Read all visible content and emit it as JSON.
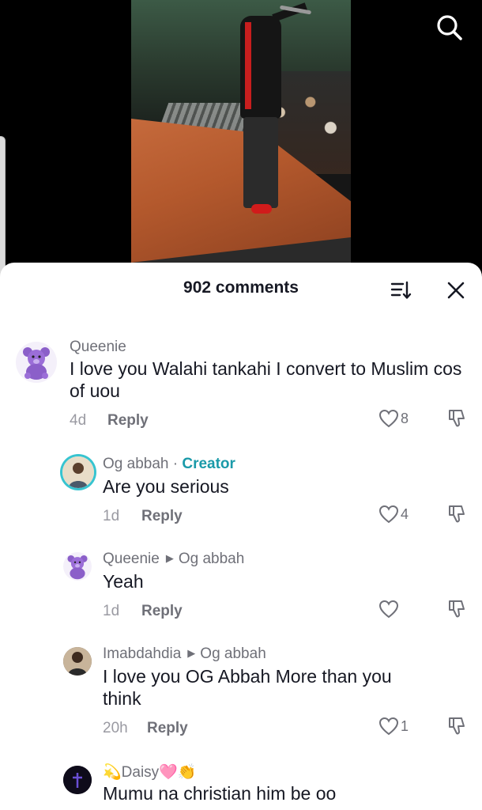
{
  "header": {
    "comment_count": "902 comments"
  },
  "icons": {
    "search": "search-icon",
    "sort": "sort-icon",
    "close": "close-icon",
    "like": "heart-outline-icon",
    "dislike": "thumbs-down-outline-icon"
  },
  "colors": {
    "creator_accent": "#1a9aa9",
    "text": "#161823",
    "muted": "#6f7078"
  },
  "comments": [
    {
      "username": "Queenie",
      "text": "I love you Walahi tankahi I convert to Muslim cos of uou",
      "time": "4d",
      "reply_label": "Reply",
      "likes": "8"
    },
    {
      "username": "Og abbah",
      "badge": "Creator",
      "text": "Are you serious",
      "time": "1d",
      "reply_label": "Reply",
      "likes": "4"
    },
    {
      "username": "Queenie",
      "reply_to": "Og abbah",
      "text": "Yeah",
      "time": "1d",
      "reply_label": "Reply",
      "likes": ""
    },
    {
      "username": "Imabdahdia",
      "reply_to": "Og abbah",
      "text": "I love you OG Abbah More than you think",
      "time": "20h",
      "reply_label": "Reply",
      "likes": "1"
    },
    {
      "username": "💫Daisy🩷👏",
      "text": "Mumu na christian him be oo"
    }
  ]
}
